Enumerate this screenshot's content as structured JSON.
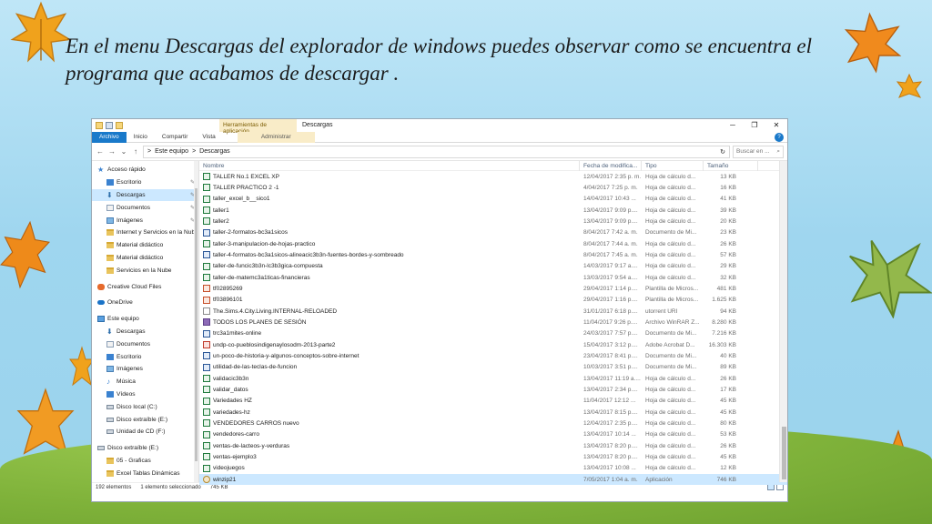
{
  "slide": {
    "title": "En el menu Descargas del explorador de windows puedes observar como se encuentra el programa que acabamos de descargar ."
  },
  "colors": {
    "accent": "#1979ca",
    "selection": "#cce8ff",
    "leaf_orange": "#f0a21c",
    "leaf_green": "#93b84b"
  },
  "explorer": {
    "window_title": "Descargas",
    "context_tab": "Herramientas de aplicación",
    "window_buttons": [
      "─",
      "❐",
      "✕"
    ],
    "ribbon_tabs": [
      "Archivo",
      "Inicio",
      "Compartir",
      "Vista"
    ],
    "admin_tab": "Administrar",
    "help": "?",
    "nav_back": "←",
    "nav_fwd": "→",
    "nav_down": "⌄",
    "nav_up": "↑",
    "address": [
      "Este equipo",
      "Descargas"
    ],
    "address_sep": ">",
    "refresh": "↻",
    "search_placeholder": "Buscar en ...",
    "search_icon": "⌕",
    "columns": {
      "name": "Nombre",
      "date": "Fecha de modifica...",
      "type": "Tipo",
      "size": "Tamaño"
    },
    "nav_pane": [
      {
        "label": "Acceso rápido",
        "icon": "star",
        "indent": false,
        "pinned": false
      },
      {
        "label": "Escritorio",
        "icon": "blue",
        "indent": true,
        "pinned": true
      },
      {
        "label": "Descargas",
        "icon": "dl",
        "indent": true,
        "pinned": true,
        "selected": true
      },
      {
        "label": "Documentos",
        "icon": "doc",
        "indent": true,
        "pinned": true
      },
      {
        "label": "Imágenes",
        "icon": "pic",
        "indent": true,
        "pinned": true
      },
      {
        "label": "Internet y Servicios en la Nube",
        "icon": "fold",
        "indent": true,
        "pinned": false
      },
      {
        "label": "Material didáctico",
        "icon": "fold",
        "indent": true,
        "pinned": false
      },
      {
        "label": "Material didáctico",
        "icon": "fold",
        "indent": true,
        "pinned": false
      },
      {
        "label": "Servicios en la Nube",
        "icon": "fold",
        "indent": true,
        "pinned": false
      },
      {
        "label": "Creative Cloud Files",
        "icon": "cloud",
        "indent": false,
        "pinned": false,
        "gap": true
      },
      {
        "label": "OneDrive",
        "icon": "od",
        "indent": false,
        "pinned": false,
        "gap": true
      },
      {
        "label": "Este equipo",
        "icon": "pc",
        "indent": false,
        "pinned": false,
        "gap": true
      },
      {
        "label": "Descargas",
        "icon": "dl",
        "indent": true,
        "pinned": false
      },
      {
        "label": "Documentos",
        "icon": "doc",
        "indent": true,
        "pinned": false
      },
      {
        "label": "Escritorio",
        "icon": "blue",
        "indent": true,
        "pinned": false
      },
      {
        "label": "Imágenes",
        "icon": "pic",
        "indent": true,
        "pinned": false
      },
      {
        "label": "Música",
        "icon": "music",
        "indent": true,
        "pinned": false
      },
      {
        "label": "Vídeos",
        "icon": "blue",
        "indent": true,
        "pinned": false
      },
      {
        "label": "Disco local (C:)",
        "icon": "drive",
        "indent": true,
        "pinned": false
      },
      {
        "label": "Disco extraíble (E:)",
        "icon": "drive",
        "indent": true,
        "pinned": false
      },
      {
        "label": "Unidad de CD (F:)",
        "icon": "drive",
        "indent": true,
        "pinned": false
      },
      {
        "label": "Disco extraíble (E:)",
        "icon": "drive",
        "indent": false,
        "pinned": false,
        "gap": true
      },
      {
        "label": "05 - Graficas",
        "icon": "fold",
        "indent": true,
        "pinned": false
      },
      {
        "label": "Excel Tablas Dinámicas",
        "icon": "fold",
        "indent": true,
        "pinned": false
      }
    ],
    "pin_glyph": "✎",
    "files": [
      {
        "name": "TALLER No.1 EXCEL XP",
        "date": "12/04/2017 2:35 p. m.",
        "type": "Hoja de cálculo d...",
        "size": "13 KB",
        "icon": "xls"
      },
      {
        "name": "TALLER PRACTICO 2 -1",
        "date": "4/04/2017 7:25 p. m.",
        "type": "Hoja de cálculo d...",
        "size": "16 KB",
        "icon": "xls"
      },
      {
        "name": "taller_excel_b__sico1",
        "date": "14/04/2017 10:43 ...",
        "type": "Hoja de cálculo d...",
        "size": "41 KB",
        "icon": "xls"
      },
      {
        "name": "taller1",
        "date": "13/04/2017 9:09 p....",
        "type": "Hoja de cálculo d...",
        "size": "39 KB",
        "icon": "xls"
      },
      {
        "name": "taller2",
        "date": "13/04/2017 9:09 p....",
        "type": "Hoja de cálculo d...",
        "size": "20 KB",
        "icon": "xls"
      },
      {
        "name": "taller-2-formatos-bc3a1sicos",
        "date": "8/04/2017 7:42 a. m.",
        "type": "Documento de Mi...",
        "size": "23 KB",
        "icon": "word"
      },
      {
        "name": "taller-3-manipulacion-de-hojas-practico",
        "date": "8/04/2017 7:44 a. m.",
        "type": "Hoja de cálculo d...",
        "size": "26 KB",
        "icon": "xls"
      },
      {
        "name": "taller-4-formatos-bc3a1sicos-alineacic3b3n-fuentes-bordes-y-sombreado",
        "date": "8/04/2017 7:45 a. m.",
        "type": "Hoja de cálculo d...",
        "size": "57 KB",
        "icon": "word"
      },
      {
        "name": "taller-de-funcic3b3n-lc3b3gica-compuesta",
        "date": "14/03/2017 9:17 a....",
        "type": "Hoja de cálculo d...",
        "size": "29 KB",
        "icon": "xls"
      },
      {
        "name": "taller-de-matemc3a1ticas-financieras",
        "date": "13/03/2017 9:54 a....",
        "type": "Hoja de cálculo d...",
        "size": "32 KB",
        "icon": "xls"
      },
      {
        "name": "tf02895269",
        "date": "29/04/2017 1:14 p....",
        "type": "Plantilla de Micros...",
        "size": "481 KB",
        "icon": "ppt"
      },
      {
        "name": "tf03896101",
        "date": "29/04/2017 1:16 p....",
        "type": "Plantilla de Micros...",
        "size": "1.625 KB",
        "icon": "ppt"
      },
      {
        "name": "The.Sims.4.City.Living.INTERNAL-RELOADED",
        "date": "31/01/2017 6:18 p....",
        "type": "utorrent URI",
        "size": "94 KB",
        "icon": "utor"
      },
      {
        "name": "TODOS LOS PLANES DE SESIÓN",
        "date": "11/04/2017 9:26 p....",
        "type": "Archivo WinRAR Z...",
        "size": "8.280 KB",
        "icon": "rar"
      },
      {
        "name": "trc3a1mites-online",
        "date": "24/03/2017 7:57 p....",
        "type": "Documento de Mi...",
        "size": "7.216 KB",
        "icon": "word"
      },
      {
        "name": "undp-co-pueblosindigenaylosodm-2013-parte2",
        "date": "15/04/2017 3:12 p....",
        "type": "Adobe Acrobat D...",
        "size": "16.303 KB",
        "icon": "pdf"
      },
      {
        "name": "un-poco-de-historia-y-algunos-conceptos-sobre-internet",
        "date": "23/04/2017 8:41 p....",
        "type": "Documento de Mi...",
        "size": "40 KB",
        "icon": "word"
      },
      {
        "name": "utilidad-de-las-teclas-de-funcion",
        "date": "10/03/2017 3:51 p....",
        "type": "Documento de Mi...",
        "size": "89 KB",
        "icon": "word"
      },
      {
        "name": "validacic3b3n",
        "date": "13/04/2017 11:19 a....",
        "type": "Hoja de cálculo d...",
        "size": "26 KB",
        "icon": "xls"
      },
      {
        "name": "validar_datos",
        "date": "13/04/2017 2:34 p....",
        "type": "Hoja de cálculo d...",
        "size": "17 KB",
        "icon": "xls"
      },
      {
        "name": "Variedades HZ",
        "date": "11/04/2017 12:12 ...",
        "type": "Hoja de cálculo d...",
        "size": "45 KB",
        "icon": "xls"
      },
      {
        "name": "variedades-hz",
        "date": "13/04/2017 8:15 p....",
        "type": "Hoja de cálculo d...",
        "size": "45 KB",
        "icon": "xls"
      },
      {
        "name": "VENDEDORES CARROS nuevo",
        "date": "12/04/2017 2:35 p....",
        "type": "Hoja de cálculo d...",
        "size": "80 KB",
        "icon": "xls"
      },
      {
        "name": "vendedores-carro",
        "date": "13/04/2017 10:14 ...",
        "type": "Hoja de cálculo d...",
        "size": "53 KB",
        "icon": "xls"
      },
      {
        "name": "ventas-de-lacteos-y-verduras",
        "date": "13/04/2017 8:20 p....",
        "type": "Hoja de cálculo d...",
        "size": "26 KB",
        "icon": "xls"
      },
      {
        "name": "ventas-ejemplo3",
        "date": "13/04/2017 8:20 p....",
        "type": "Hoja de cálculo d...",
        "size": "45 KB",
        "icon": "xls"
      },
      {
        "name": "videojuegos",
        "date": "13/04/2017 10:08 ...",
        "type": "Hoja de cálculo d...",
        "size": "12 KB",
        "icon": "xls"
      },
      {
        "name": "winzip21",
        "date": "7/05/2017 1:04 a. m.",
        "type": "Aplicación",
        "size": "746 KB",
        "icon": "exe",
        "selected": true
      }
    ],
    "status": {
      "count": "192 elementos",
      "selected": "1 elemento seleccionado",
      "size": "745 KB"
    }
  }
}
